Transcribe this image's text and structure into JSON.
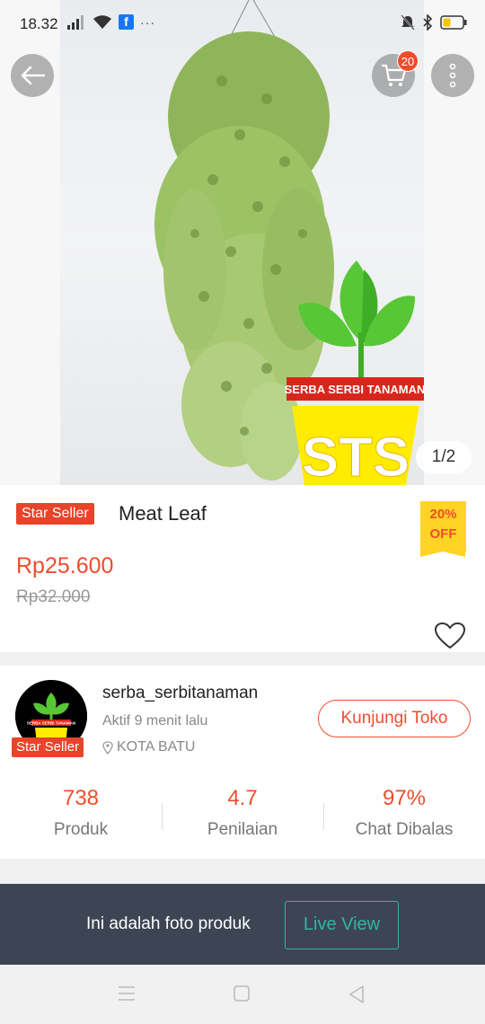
{
  "status_bar": {
    "time": "18.32",
    "fb_label": "f",
    "more_label": "···"
  },
  "hero": {
    "pager_text": "1/2",
    "cart_count": "20",
    "watermark_text": "SERBA SERBI TANAMAN",
    "logo_letters": "STS"
  },
  "product": {
    "badge": "Star Seller",
    "name": "Meat Leaf",
    "discount_pct": "20%",
    "discount_off": "OFF",
    "price": "Rp25.600",
    "old_price": "Rp32.000"
  },
  "shop": {
    "name": "serba_serbitanaman",
    "active": "Aktif 9 menit lalu",
    "location": "KOTA BATU",
    "badge": "Star Seller",
    "visit_label": "Kunjungi Toko",
    "avatar_text": "SERBA SERBI TANAMAN",
    "stats": [
      {
        "value": "738",
        "label": "Produk"
      },
      {
        "value": "4.7",
        "label": "Penilaian"
      },
      {
        "value": "97%",
        "label": "Chat Dibalas"
      }
    ]
  },
  "bottom_bar": {
    "text": "Ini adalah foto produk",
    "live_label": "Live View"
  },
  "colors": {
    "accent": "#ee4d2d",
    "teal": "#2fb5a6",
    "bar_bg": "#3d4454",
    "discount_bg": "#ffd424"
  }
}
